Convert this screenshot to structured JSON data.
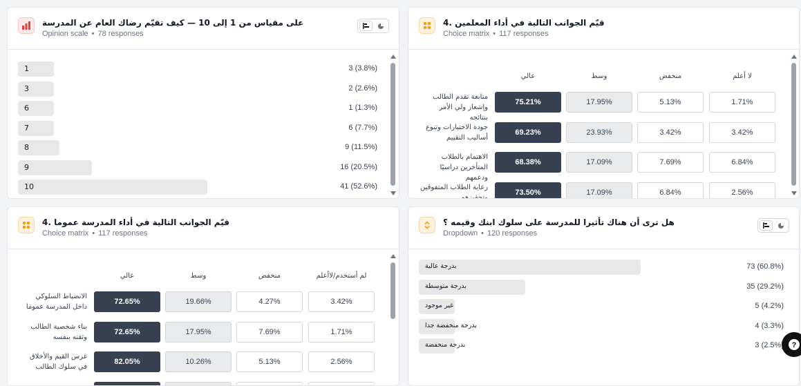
{
  "cards": {
    "opinion": {
      "title": "على مقياس من 1 إلى 10 — كيف تقيّم رضاك العام عن المدرسة",
      "type": "Opinion scale",
      "responses": "78 responses",
      "rows": [
        {
          "label": "1",
          "count": "3 (3.8%)",
          "pct": 3.8
        },
        {
          "label": "3",
          "count": "2 (2.6%)",
          "pct": 2.6
        },
        {
          "label": "6",
          "count": "1 (1.3%)",
          "pct": 1.3
        },
        {
          "label": "7",
          "count": "6 (7.7%)",
          "pct": 7.7
        },
        {
          "label": "8",
          "count": "9 (11.5%)",
          "pct": 11.5
        },
        {
          "label": "9",
          "count": "16 (20.5%)",
          "pct": 20.5
        },
        {
          "label": "10",
          "count": "41 (52.6%)",
          "pct": 52.6
        }
      ]
    },
    "teachers": {
      "title": "قيّم الجوانب التالية في أداء المعلمين .4",
      "type": "Choice matrix",
      "responses": "117 responses",
      "columns": [
        "عالي",
        "وسط",
        "منخفض",
        "لا أعلم"
      ],
      "rows": [
        {
          "label": "متابعة تقدم الطالب وإشعار ولي الأمر بنتائجه",
          "values": [
            "75.21%",
            "17.95%",
            "5.13%",
            "1.71%"
          ]
        },
        {
          "label": "جودة الاختبارات وتنوع أساليب التقييم",
          "values": [
            "69.23%",
            "23.93%",
            "3.42%",
            "3.42%"
          ]
        },
        {
          "label": "الاهتمام بالطلاب المتأخرين دراسيًا ودعمهم",
          "values": [
            "68.38%",
            "17.09%",
            "7.69%",
            "6.84%"
          ]
        },
        {
          "label": "رعاية الطلاب المتفوقين وتحفيزهم",
          "values": [
            "73.50%",
            "17.09%",
            "6.84%",
            "2.56%"
          ]
        }
      ]
    },
    "school": {
      "title": "قيّم الجوانب التالية في أداء المدرسة عموما .4",
      "type": "Choice matrix",
      "responses": "117 responses",
      "columns": [
        "عالي",
        "وسط",
        "منخفض",
        "لم أستخدم/لاأعلم"
      ],
      "rows": [
        {
          "label": "الانضباط السلوكي داخل المدرسة عموما",
          "values": [
            "72.65%",
            "19.66%",
            "4.27%",
            "3.42%"
          ]
        },
        {
          "label": "بناء شخصية الطالب وثقته بنفسه",
          "values": [
            "72.65%",
            "17.95%",
            "7.69%",
            "1.71%"
          ]
        },
        {
          "label": "غرس القيم والأخلاق في سلوك الطالب",
          "values": [
            "82.05%",
            "10.26%",
            "5.13%",
            "2.56%"
          ]
        },
        {
          "label": "",
          "values": [
            "",
            "",
            "",
            ""
          ]
        }
      ]
    },
    "dropdown": {
      "title": "هل ترى أن هناك تأثيرا للمدرسة على سلوك ابنك وقيمه ؟",
      "type": "Dropdown",
      "responses": "120 responses",
      "rows": [
        {
          "label": "بدرجة عالية",
          "count": "73 (60.8%)",
          "pct": 60.8
        },
        {
          "label": "بدرجة متوسطة",
          "count": "35 (29.2%)",
          "pct": 29.2
        },
        {
          "label": "غير موجود",
          "count": "5 (4.2%)",
          "pct": 4.2
        },
        {
          "label": "بدرجة منخفضة جدا",
          "count": "4 (3.3%)",
          "pct": 3.3
        },
        {
          "label": "بدرجة منخفضة",
          "count": "3 (2.5%)",
          "pct": 2.5
        }
      ]
    }
  },
  "separator": "•",
  "colors": {
    "dark_cell": "#374151",
    "light_cell": "#e9eaec",
    "bar": "#e8e8e8",
    "accent_red": "#e53e3e",
    "accent_orange": "#f59e0b"
  }
}
